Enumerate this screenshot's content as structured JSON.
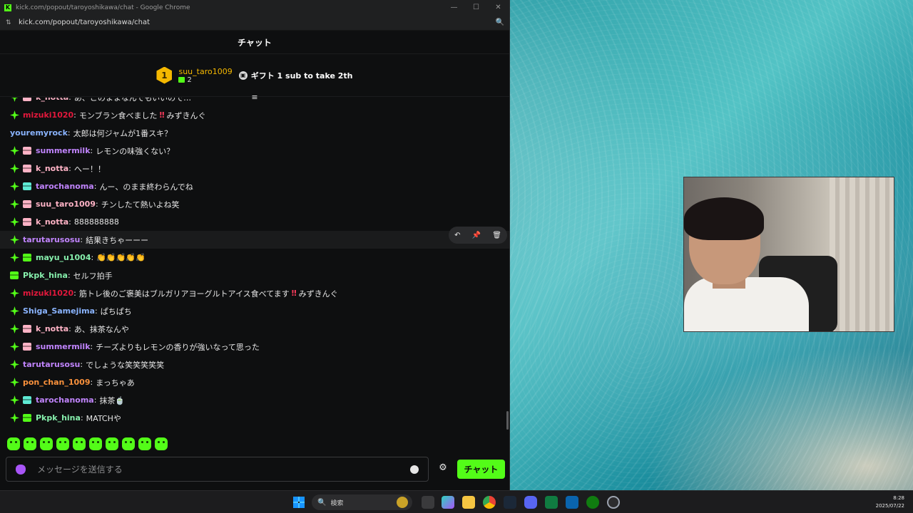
{
  "window": {
    "title": "kick.com/popout/taroyoshikawa/chat - Google Chrome",
    "url": "kick.com/popout/taroyoshikawa/chat",
    "min_glyph": "—",
    "max_glyph": "☐",
    "close_glyph": "✕"
  },
  "chat": {
    "header": "チャット",
    "pinned_gifter": {
      "rank": "1",
      "name": "suu_taro1009",
      "count": "2"
    },
    "gift_cta": "ギフト 1 sub to take 2th",
    "collapse_glyph": "≡"
  },
  "messages": [
    {
      "badges": [
        "star",
        "sub"
      ],
      "user": "k_notta",
      "color": "#ffb3c6",
      "text": "あ、このままなんでもいいので…"
    },
    {
      "badges": [
        "star"
      ],
      "user": "mizuki1020",
      "color": "#e3183c",
      "text": "モンブラン食べました",
      "bang": "‼",
      "suffix": "みずきんぐ"
    },
    {
      "badges": [],
      "user": "youremyrock",
      "color": "#8ab4ff",
      "text": "太郎は何ジャムが1番スキ？"
    },
    {
      "badges": [
        "star",
        "sub"
      ],
      "user": "summermilk",
      "color": "#c084fc",
      "text": "レモンの味強くない？"
    },
    {
      "badges": [
        "star",
        "sub"
      ],
      "user": "k_notta",
      "color": "#ffb3c6",
      "text": "へー！！"
    },
    {
      "badges": [
        "star",
        "subteal"
      ],
      "user": "tarochanoma",
      "color": "#c084fc",
      "text": "んー、のまま終わらんでね"
    },
    {
      "badges": [
        "star",
        "sub"
      ],
      "user": "suu_taro1009",
      "color": "#ffb3c6",
      "text": "チンしたて熱いよね笑"
    },
    {
      "badges": [
        "star",
        "sub"
      ],
      "user": "k_notta",
      "color": "#ffb3c6",
      "text": "888888888"
    },
    {
      "badges": [
        "star"
      ],
      "user": "tarutarusosu",
      "color": "#c084fc",
      "text": "結果きちゃーーー",
      "highlight": true
    },
    {
      "badges": [
        "star",
        "subgreen"
      ],
      "user": "mayu_u1004",
      "color": "#86efac",
      "text": "👏👏👏👏👏"
    },
    {
      "badges": [
        "subgreen"
      ],
      "user": "Pkpk_hina",
      "color": "#86efac",
      "text": "セルフ拍手"
    },
    {
      "badges": [
        "star"
      ],
      "user": "mizuki1020",
      "color": "#e3183c",
      "text": "筋トレ後のご褒美はブルガリアヨーグルトアイス食べてます",
      "bang": "‼",
      "suffix": "みずきんぐ"
    },
    {
      "badges": [
        "star"
      ],
      "user": "Shiga_Samejima",
      "color": "#8ab4ff",
      "text": "ぱちぱち"
    },
    {
      "badges": [
        "star",
        "sub"
      ],
      "user": "k_notta",
      "color": "#ffb3c6",
      "text": "あ、抹茶なんや"
    },
    {
      "badges": [
        "star",
        "sub"
      ],
      "user": "summermilk",
      "color": "#c084fc",
      "text": "チーズよりもレモンの香りが強いなって思った"
    },
    {
      "badges": [
        "star"
      ],
      "user": "tarutarusosu",
      "color": "#c084fc",
      "text": "でしょうな笑笑笑笑笑"
    },
    {
      "badges": [
        "star"
      ],
      "user": "pon_chan_1009",
      "color": "#fb923c",
      "text": "まっちゃあ"
    },
    {
      "badges": [
        "star",
        "subteal"
      ],
      "user": "tarochanoma",
      "color": "#c084fc",
      "text": "抹茶🍵"
    },
    {
      "badges": [
        "star",
        "subgreen"
      ],
      "user": "Pkpk_hina",
      "color": "#86efac",
      "text": "MATCHや"
    }
  ],
  "composer": {
    "placeholder": "メッセージを送信する",
    "send_label": "チャット",
    "settings_glyph": "⚙"
  },
  "msg_actions": {
    "reply": "↶",
    "pin": "📌",
    "delete": "🗑"
  },
  "taskbar": {
    "search_placeholder": "検索",
    "search_glyph": "🔍",
    "time": "8:28",
    "date": "2025/07/22"
  },
  "colors": {
    "kick_green": "#53fc18",
    "bg": "#0e0f10",
    "gold": "#f5b800",
    "accent_red": "#e3183c"
  },
  "icons": {
    "emotes": [
      "emote-1",
      "emote-2",
      "emote-3",
      "emote-4",
      "emote-5",
      "emote-6",
      "emote-7",
      "emote-8",
      "emote-9",
      "emote-10"
    ]
  }
}
